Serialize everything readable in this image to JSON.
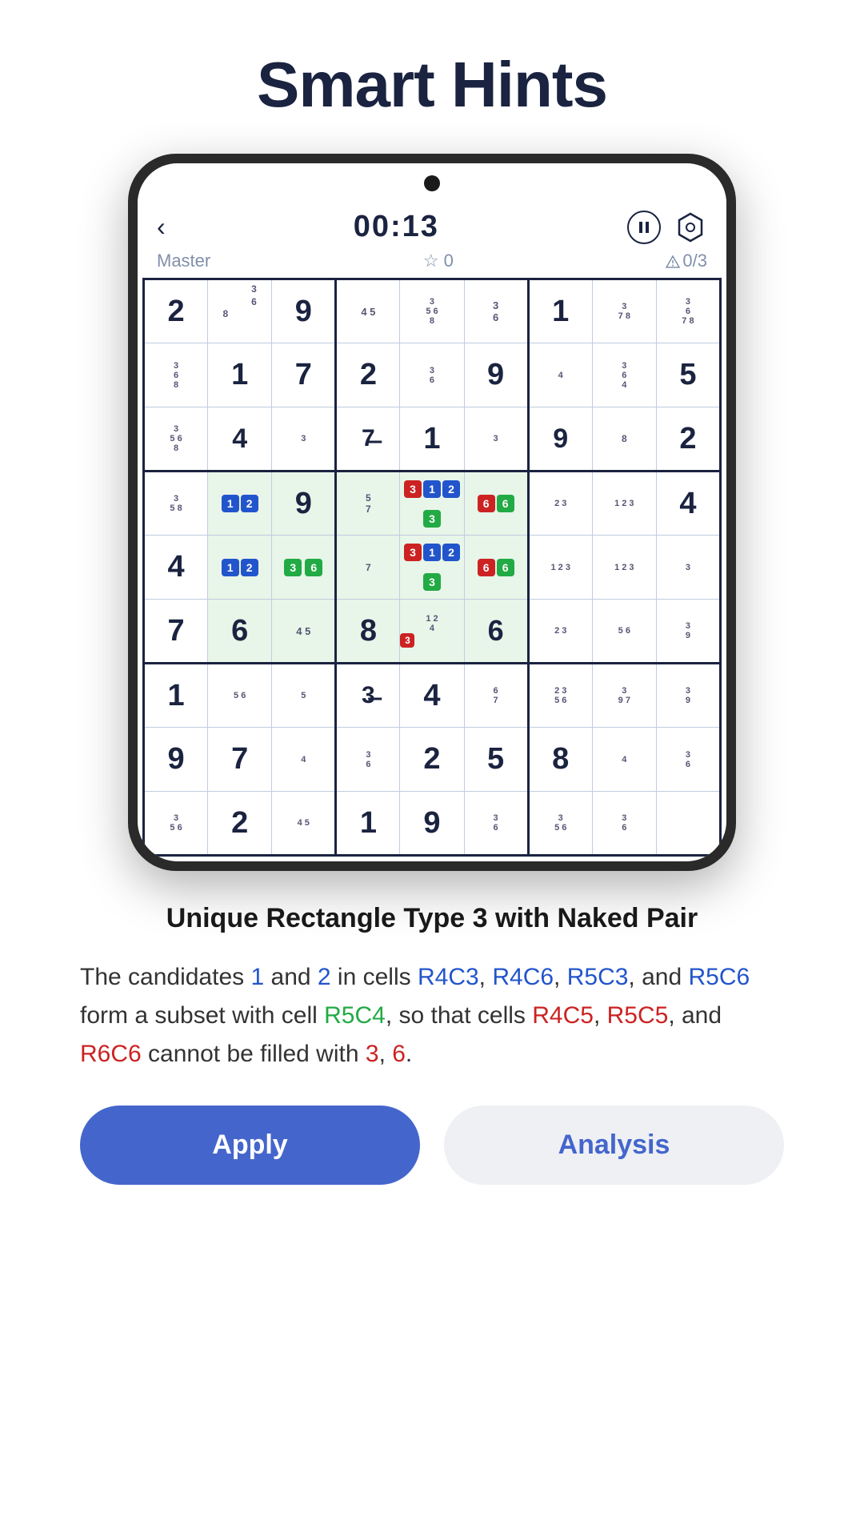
{
  "page": {
    "title": "Smart Hints"
  },
  "phone": {
    "timer": "00:13",
    "difficulty": "Master",
    "stars": "0",
    "errors": "0/3"
  },
  "hint": {
    "title": "Unique Rectangle Type 3 with Naked Pair",
    "text_parts": [
      "The candidates ",
      "1",
      " and ",
      "2",
      " in cells ",
      "R4C3",
      ", ",
      "R4C6",
      ", ",
      "R5C3",
      ", and ",
      "R5C6",
      " form a subset with cell ",
      "R5C4",
      ", so that cells ",
      "R4C5",
      ", ",
      "R5C5",
      ", and ",
      "R6C6",
      " cannot be filled with ",
      "3",
      ", ",
      "6",
      "."
    ]
  },
  "buttons": {
    "apply": "Apply",
    "analysis": "Analysis"
  }
}
